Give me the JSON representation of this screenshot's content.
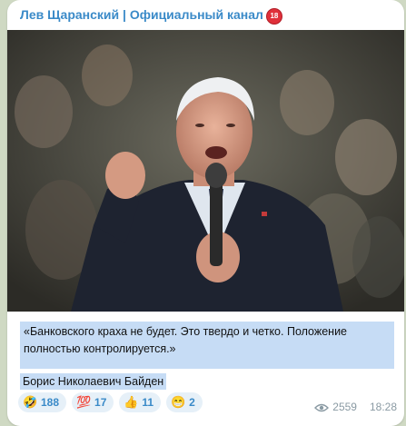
{
  "channel": {
    "name": "Лев Щаранский | Официальный канал",
    "age_badge": "18"
  },
  "message": {
    "quote": "«Банковского краха не будет. Это твердо и четко. Положение полностью контролируется.»",
    "author": "Борис Николаевич Байден",
    "views": "2559",
    "time": "18:28"
  },
  "reactions": [
    {
      "emoji": "🤣",
      "icon": "rofl-emoji-icon",
      "count": "188"
    },
    {
      "emoji": "💯",
      "icon": "hundred-points-emoji-icon",
      "count": "17"
    },
    {
      "emoji": "👍",
      "icon": "thumbs-up-emoji-icon",
      "count": "11"
    },
    {
      "emoji": "😁",
      "icon": "grinning-emoji-icon",
      "count": "2"
    }
  ],
  "colors": {
    "accent": "#3a8ac8",
    "highlight": "#c6dcf5",
    "background": "#cfd9c3"
  }
}
